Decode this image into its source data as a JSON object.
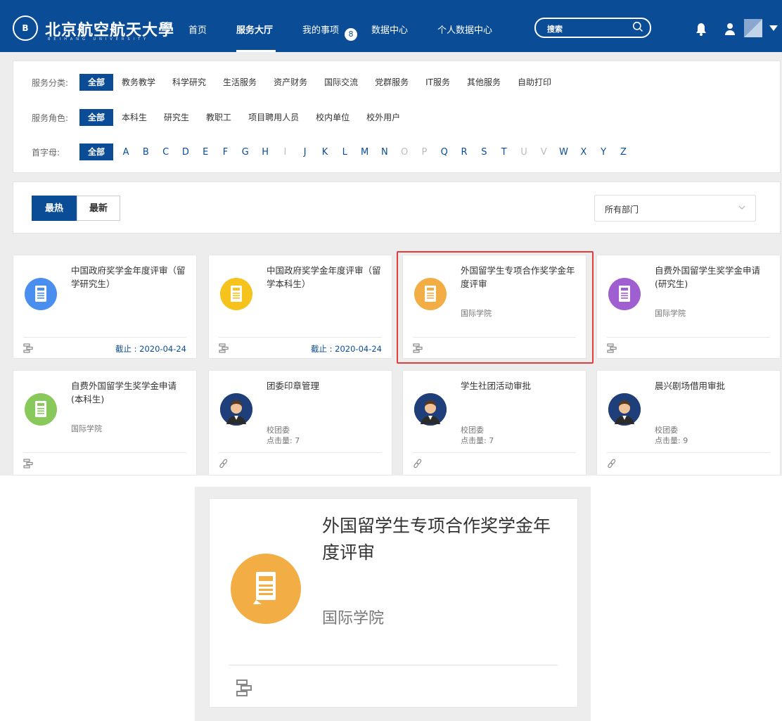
{
  "nav": {
    "logo_cn": "北京航空航天大學",
    "logo_en": "BEIHANG UNIVERSITY",
    "logo_seal": "B",
    "links": [
      "首页",
      "服务大厅",
      "我的事项",
      "数据中心",
      "个人数据中心"
    ],
    "badge": "8",
    "search_placeholder": "搜索",
    "active": "服务大厅"
  },
  "filters": {
    "category_label": "服务分类:",
    "categories": [
      "全部",
      "教务教学",
      "科学研究",
      "生活服务",
      "资产财务",
      "国际交流",
      "党群服务",
      "IT服务",
      "其他服务",
      "自助打印"
    ],
    "role_label": "服务角色:",
    "roles": [
      "全部",
      "本科生",
      "研究生",
      "教职工",
      "项目聘用人员",
      "校内单位",
      "校外用户"
    ],
    "letter_label": "首字母:",
    "letter_all": "全部",
    "letters": [
      "A",
      "B",
      "C",
      "D",
      "E",
      "F",
      "G",
      "H",
      "I",
      "J",
      "K",
      "L",
      "M",
      "N",
      "O",
      "P",
      "Q",
      "R",
      "S",
      "T",
      "U",
      "V",
      "W",
      "X",
      "Y",
      "Z"
    ],
    "disabled_letters": [
      "I",
      "O",
      "P",
      "U",
      "V"
    ]
  },
  "sort": {
    "hot": "最热",
    "new": "最新",
    "dept_select": "所有部门"
  },
  "colors": {
    "brand": "#0b4c97",
    "blue_icon": "#4a8ff0",
    "yellow_icon": "#f6c21c",
    "orange_icon": "#f2ad45",
    "purple_icon": "#a05fd1",
    "green_icon": "#89c95b",
    "highlight": "#e43c3c"
  },
  "cards": [
    {
      "title": "中国政府奖学金年度评审（留学研究生）",
      "dept": "",
      "clicks": "",
      "deadline": "截止 : 2020-04-24",
      "icon": "document-icon",
      "color": "#4a8ff0",
      "foot": "workflow-icon"
    },
    {
      "title": "中国政府奖学金年度评审（留学本科生）",
      "dept": "",
      "clicks": "",
      "deadline": "截止 : 2020-04-24",
      "icon": "document-icon",
      "color": "#f6c21c",
      "foot": "workflow-icon"
    },
    {
      "title": "外国留学生专项合作奖学金年度评审",
      "dept": "国际学院",
      "clicks": "",
      "deadline": "",
      "icon": "document-icon",
      "color": "#f2ad45",
      "foot": "workflow-icon"
    },
    {
      "title": "自费外国留学生奖学金申请(研究生)",
      "dept": "国际学院",
      "clicks": "",
      "deadline": "",
      "icon": "document-icon",
      "color": "#a05fd1",
      "foot": "workflow-icon"
    },
    {
      "title": "自费外国留学生奖学金申请(本科生)",
      "dept": "国际学院",
      "clicks": "",
      "deadline": "",
      "icon": "document-icon",
      "color": "#89c95b",
      "foot": "workflow-icon"
    },
    {
      "title": "团委印章管理",
      "dept": "校团委",
      "clicks": "点击量: 7",
      "deadline": "",
      "icon": "person-avatar-icon",
      "color": "#1f3f7a",
      "foot": "link-icon"
    },
    {
      "title": "学生社团活动审批",
      "dept": "校团委",
      "clicks": "点击量: 7",
      "deadline": "",
      "icon": "person-avatar-icon",
      "color": "#1f3f7a",
      "foot": "link-icon"
    },
    {
      "title": "晨兴剧场借用审批",
      "dept": "校团委",
      "clicks": "点击量: 9",
      "deadline": "",
      "icon": "person-avatar-icon",
      "color": "#1f3f7a",
      "foot": "link-icon"
    }
  ],
  "zoom": {
    "title": "外国留学生专项合作奖学金年度评审",
    "dept": "国际学院"
  }
}
